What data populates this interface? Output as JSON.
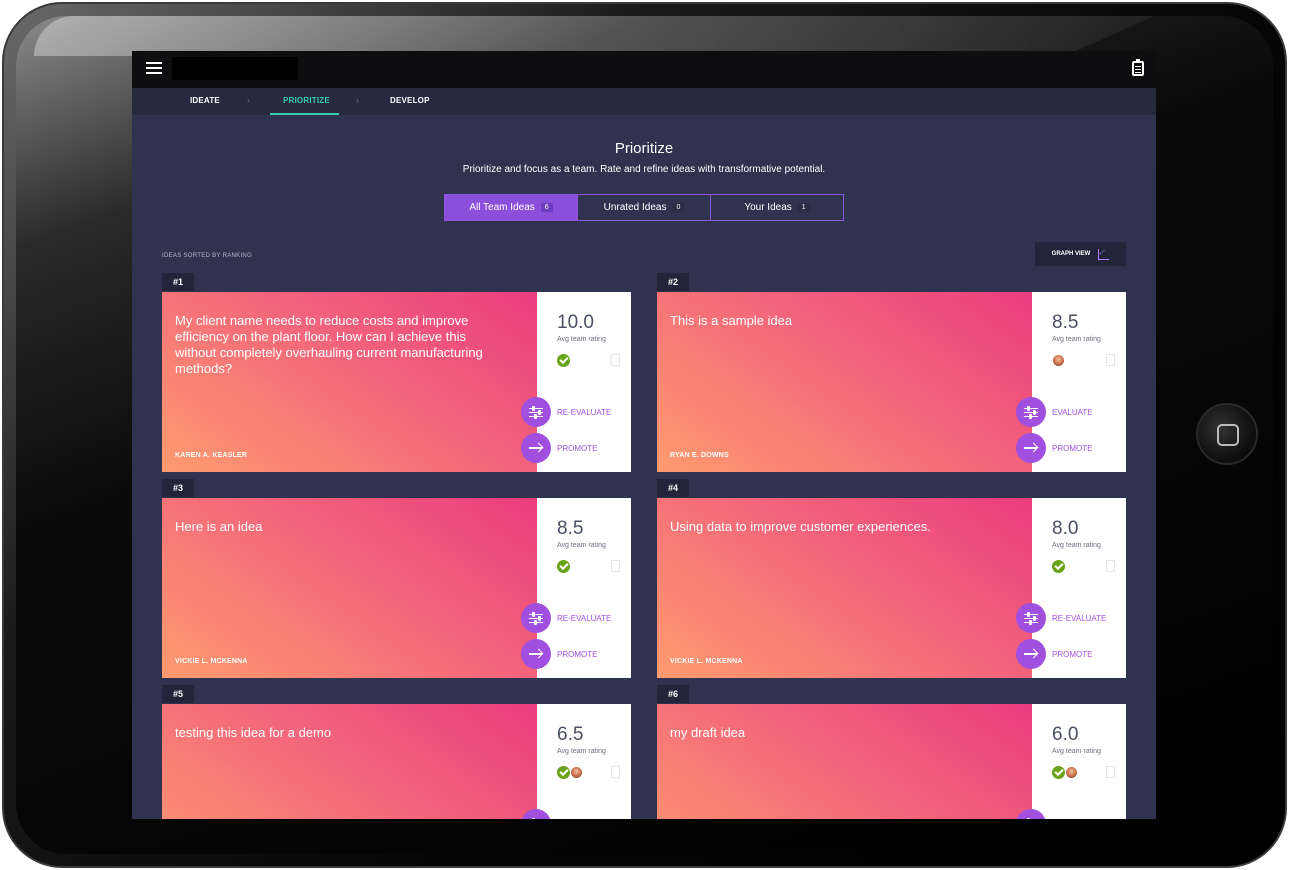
{
  "nav": {
    "steps": [
      "IDEATE",
      "PRIORITIZE",
      "DEVELOP"
    ]
  },
  "page": {
    "title": "Prioritize",
    "subtitle": "Prioritize and focus as a team. Rate and refine ideas with transformative potential."
  },
  "filters": [
    {
      "label": "All Team Ideas",
      "count": "6"
    },
    {
      "label": "Unrated Ideas",
      "count": "0"
    },
    {
      "label": "Your Ideas",
      "count": "1"
    }
  ],
  "sort_label": "IDEAS SORTED BY RANKING",
  "graph_view_label": "GRAPH VIEW",
  "rating_label": "Avg team rating",
  "cards": [
    {
      "rank": "#1",
      "text": "My client name needs to reduce costs and improve efficiency on the plant floor. How can I achieve this without completely overhauling current manufacturing methods?",
      "author": "KAREN A. KEASLER",
      "rating": "10.0",
      "action1": "RE-EVALUATE",
      "action2": "PROMOTE"
    },
    {
      "rank": "#2",
      "text": "This is a sample idea",
      "author": "RYAN E. DOWNS",
      "rating": "8.5",
      "action1": "EVALUATE",
      "action2": "PROMOTE"
    },
    {
      "rank": "#3",
      "text": "Here is an idea",
      "author": "VICKIE L. MCKENNA",
      "rating": "8.5",
      "action1": "RE-EVALUATE",
      "action2": "PROMOTE"
    },
    {
      "rank": "#4",
      "text": "Using data to improve customer experiences.",
      "author": "VICKIE L. MCKENNA",
      "rating": "8.0",
      "action1": "RE-EVALUATE",
      "action2": "PROMOTE"
    },
    {
      "rank": "#5",
      "text": "testing this idea for a demo",
      "author": "",
      "rating": "6.5",
      "action1": "",
      "action2": ""
    },
    {
      "rank": "#6",
      "text": "my draft idea",
      "author": "",
      "rating": "6.0",
      "action1": "",
      "action2": ""
    }
  ],
  "colors": {
    "accent_purple": "#a04fdf",
    "accent_teal": "#36c9b4",
    "background": "#2f3350"
  }
}
